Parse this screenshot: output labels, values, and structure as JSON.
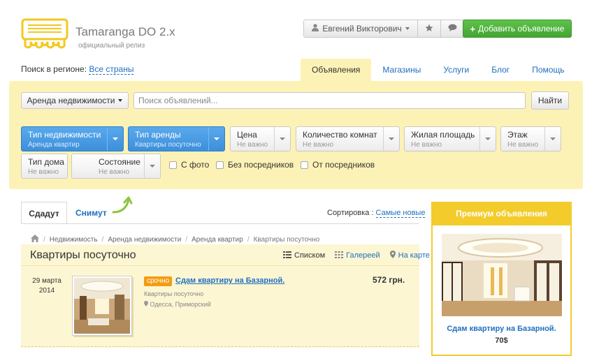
{
  "site": {
    "name": "Tamaranga DO 2.x",
    "subtitle": "официальный релиз"
  },
  "header": {
    "user_name": "Евгений Викторович",
    "favorites_icon": "star-icon",
    "messages_icon": "chat-icon",
    "add_button_label": "Добавить объявление"
  },
  "region": {
    "label": "Поиск в регионе:",
    "value": "Все страны"
  },
  "tabs": [
    {
      "label": "Объявления",
      "active": true
    },
    {
      "label": "Магазины"
    },
    {
      "label": "Услуги"
    },
    {
      "label": "Блог"
    },
    {
      "label": "Помощь"
    }
  ],
  "search": {
    "category": "Аренда недвижимости",
    "placeholder": "Поиск объявлений...",
    "button": "Найти"
  },
  "filters": [
    {
      "title": "Тип недвижимости",
      "value": "Аренда квартир",
      "active": true
    },
    {
      "title": "Тип аренды",
      "value": "Квартиры посуточно",
      "active": true
    },
    {
      "title": "Цена",
      "value": "Не важно"
    },
    {
      "title": "Количество комнат",
      "value": "Не важно"
    },
    {
      "title": "Жилая площадь",
      "value": "Не важно"
    },
    {
      "title": "Этаж",
      "value": "Не важно"
    },
    {
      "title": "Тип дома",
      "value": "Не важно"
    },
    {
      "title": "Состояние",
      "value": "Не важно"
    }
  ],
  "checkboxes": [
    "С фото",
    "Без посредников",
    "От посредников"
  ],
  "listing_tabs": {
    "active": "Сдадут",
    "other": "Снимут"
  },
  "sort": {
    "label": "Сортировка :",
    "value": "Самые новые"
  },
  "breadcrumbs": [
    "Недвижимость",
    "Аренда недвижимости",
    "Аренда квартир",
    "Квартиры посуточно"
  ],
  "list": {
    "title": "Квартиры посуточно",
    "views": {
      "list": "Списком",
      "gallery": "Галереей",
      "map": "На карте"
    }
  },
  "item": {
    "date_line1": "29 марта",
    "date_line2": "2014",
    "badge": "срочно",
    "title": "Сдам квартиру на Базарной.",
    "category": "Квартиры посуточно",
    "location": "Одесса, Приморский",
    "price": "572 грн."
  },
  "premium": {
    "heading": "Премиум объявления",
    "title": "Сдам квартиру на Базарной.",
    "price": "70$"
  },
  "colors": {
    "accent_yellow": "#fdf2b6",
    "premium_yellow": "#f3cc2c",
    "link_blue": "#1f6fbf",
    "add_green": "#4cb33b",
    "filter_blue": "#4a9ce3"
  }
}
